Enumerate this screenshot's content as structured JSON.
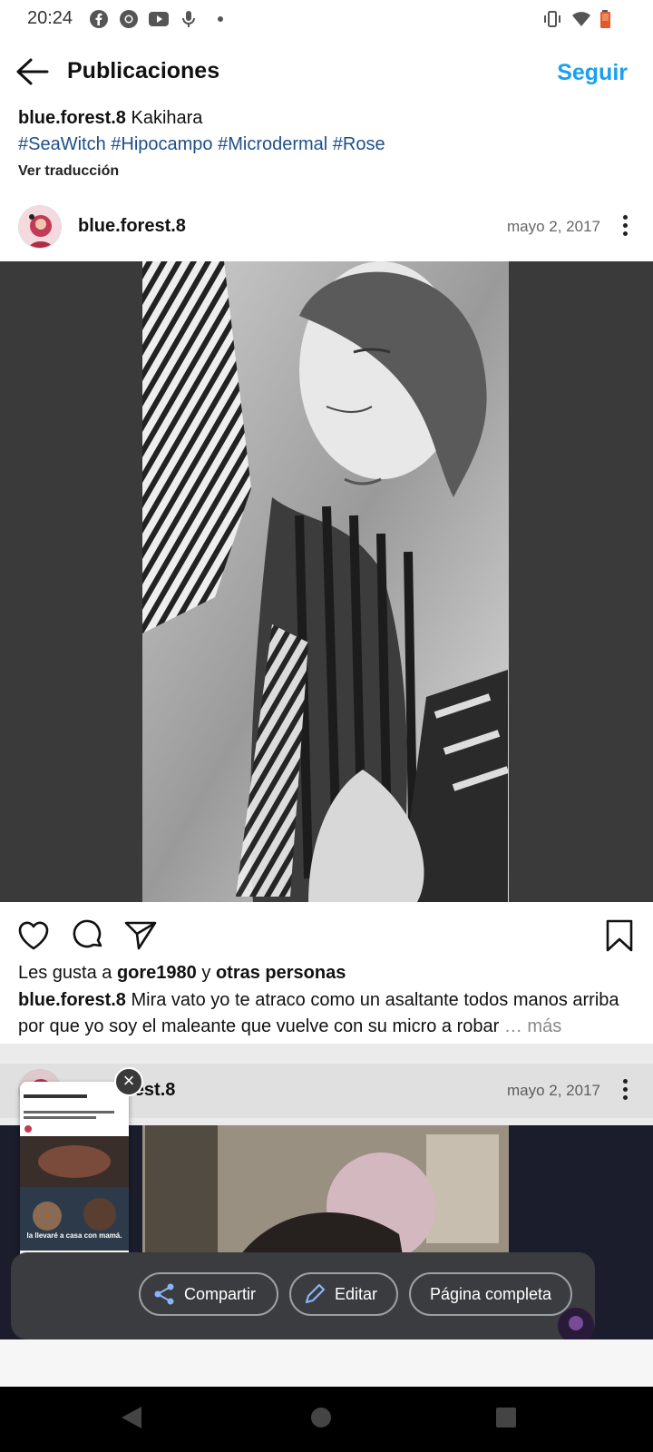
{
  "status_bar": {
    "time": "20:24",
    "left_icons": [
      "facebook-icon",
      "chrome-icon",
      "youtube-icon",
      "mic-icon"
    ],
    "right_icons": [
      "vibrate-icon",
      "wifi-icon",
      "battery-icon"
    ]
  },
  "header": {
    "title": "Publicaciones",
    "follow_label": "Seguir"
  },
  "top_caption": {
    "username": "blue.forest.8",
    "text": " Kakihara",
    "hashtags": "#SeaWitch #Hipocampo #Microdermal #Rose",
    "translate_label": "Ver traducción"
  },
  "post1": {
    "username": "blue.forest.8",
    "date": "mayo 2, 2017",
    "likes_prefix": "Les gusta a ",
    "likes_user": "gore1980",
    "likes_mid": " y ",
    "likes_others": "otras personas",
    "caption_user": "blue.forest.8",
    "caption_text": " Mira vato yo te atraco como un asaltante todos manos arriba por que yo soy el maleante que vuelve con su micro a robar",
    "more_label": "… más"
  },
  "post2": {
    "username_visible": "rest.8",
    "date": "mayo 2, 2017"
  },
  "thumbnail": {
    "meme_caption": "la llevaré a casa con mamá."
  },
  "share_sheet": {
    "share_label": "Compartir",
    "edit_label": "Editar",
    "fullpage_label": "Página completa"
  },
  "colors": {
    "accent": "#1aa0f0",
    "hashtag": "#1d4f8a",
    "panel": "#3a3c3f"
  }
}
